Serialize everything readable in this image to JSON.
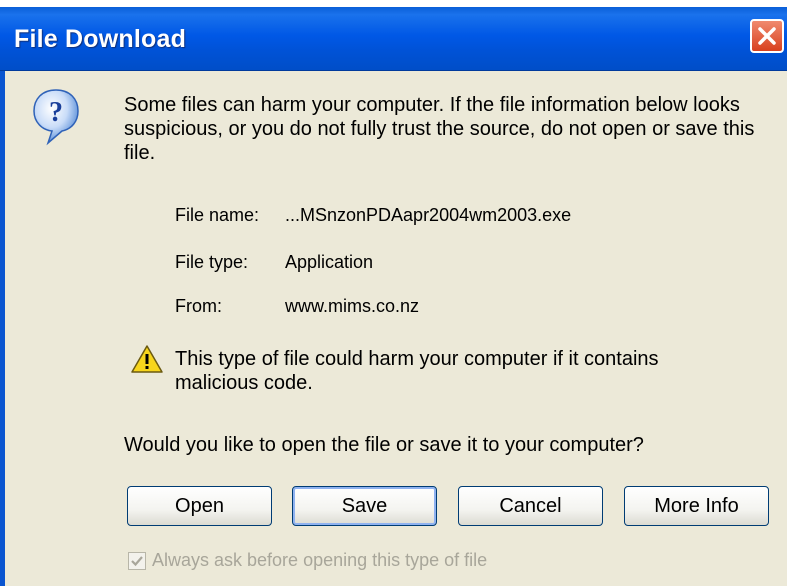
{
  "window": {
    "title": "File Download"
  },
  "message": "Some files can harm your computer. If the file information below looks suspicious, or you do not fully trust the source, do not open or save this file.",
  "file_info": [
    {
      "label": "File name:",
      "value": "...MSnzonPDAapr2004wm2003.exe"
    },
    {
      "label": "File type:",
      "value": "Application"
    },
    {
      "label": "From:",
      "value": "www.mims.co.nz"
    }
  ],
  "warning": "This type of file could harm your computer if it contains malicious code.",
  "question": "Would you like to open the file or save it to your computer?",
  "buttons": {
    "open": "Open",
    "save": "Save",
    "cancel": "Cancel",
    "more_info": "More Info"
  },
  "checkbox": {
    "label": "Always ask before opening this type of file",
    "checked": true,
    "disabled": true
  },
  "colors": {
    "titlebar": "#0058e6",
    "dialog_bg": "#ece9d8",
    "close_button": "#d8401e"
  },
  "icons": {
    "dialog": "question-icon",
    "warning": "warning-icon",
    "close": "close-icon"
  }
}
